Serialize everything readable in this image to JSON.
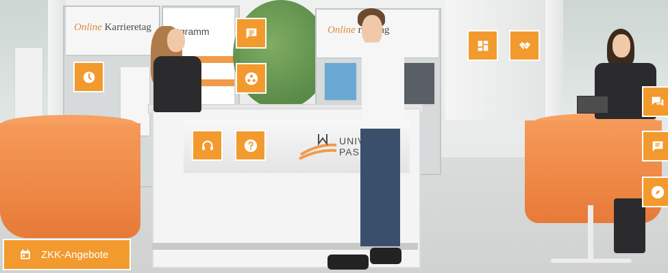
{
  "scene": {
    "poster_left": {
      "brand_script": "Online",
      "brand_title": "Karrieretag"
    },
    "poster_mid": {
      "text": "gramm"
    },
    "poster_right": {
      "brand_script": "Online",
      "brand_title": "rieretag"
    },
    "counter_logo": {
      "line1": "UNIVE",
      "line2": "PASSA"
    }
  },
  "hotspots": [
    {
      "id": "clock",
      "icon": "clock-icon"
    },
    {
      "id": "chat-lines",
      "icon": "chat-lines-icon"
    },
    {
      "id": "group",
      "icon": "group-icon"
    },
    {
      "id": "headset",
      "icon": "headset-icon"
    },
    {
      "id": "question",
      "icon": "question-icon"
    },
    {
      "id": "dashboard",
      "icon": "dashboard-icon"
    },
    {
      "id": "handshake",
      "icon": "handshake-icon"
    },
    {
      "id": "chat-right-1",
      "icon": "chat-bubbles-icon"
    },
    {
      "id": "chat-right-2",
      "icon": "chat-icon"
    },
    {
      "id": "compass",
      "icon": "compass-icon"
    }
  ],
  "cta": {
    "label": "ZKK-Angebote",
    "icon": "calendar-icon"
  },
  "colors": {
    "accent": "#f29a2e",
    "tablecloth": "#ee8745",
    "border": "#ffffff"
  }
}
